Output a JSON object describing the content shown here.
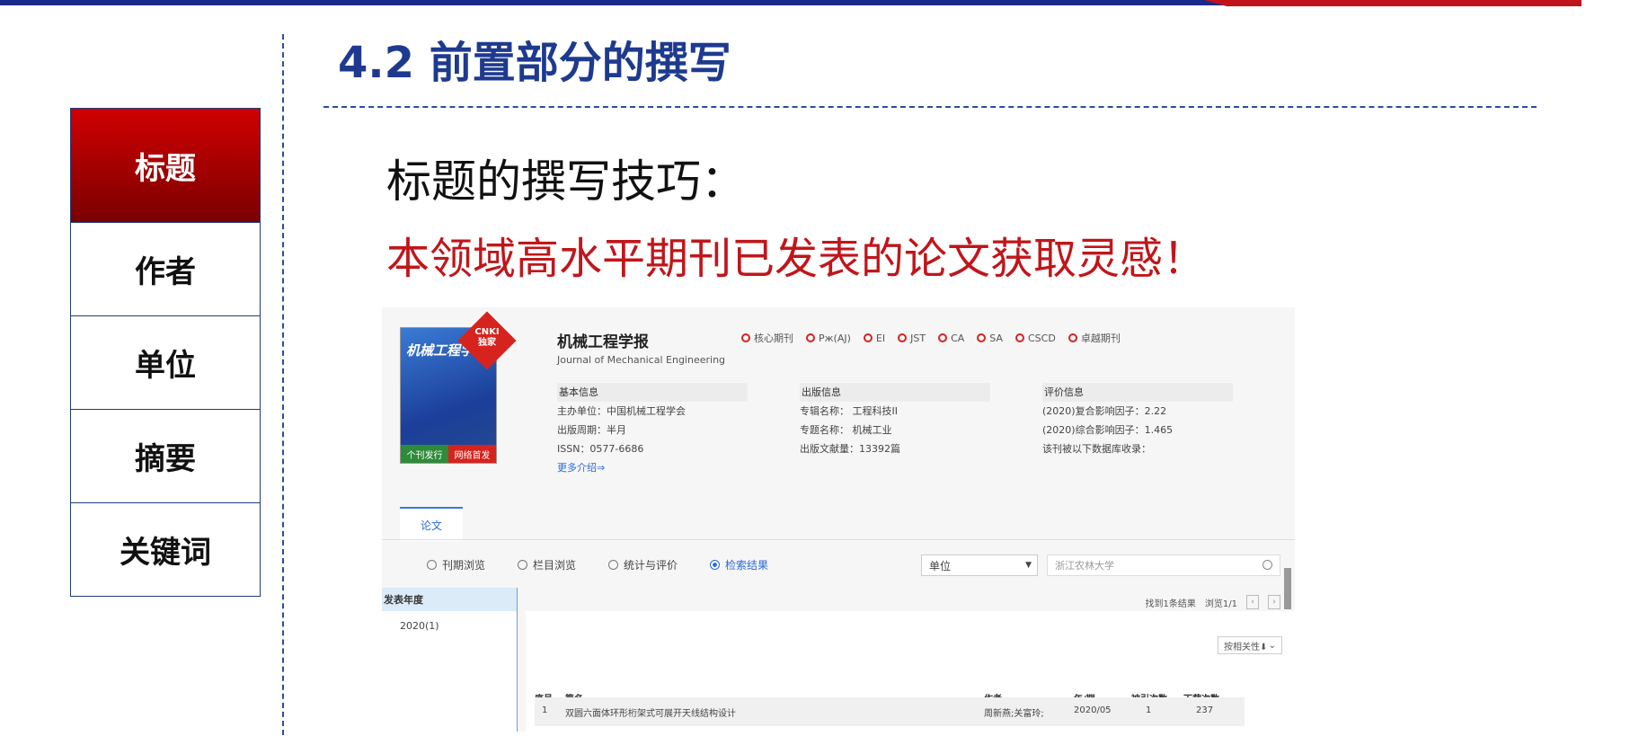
{
  "slide": {
    "title": "4.2 前置部分的撰写",
    "tabs": [
      {
        "label": "标题",
        "active": true
      },
      {
        "label": "作者",
        "active": false
      },
      {
        "label": "单位",
        "active": false
      },
      {
        "label": "摘要",
        "active": false
      },
      {
        "label": "关键词",
        "active": false
      }
    ],
    "heading": "标题的撰写技巧：",
    "highlight": "本领域高水平期刊已发表的论文获取灵感！"
  },
  "colors": {
    "primary_blue": "#1e3a8f",
    "accent_red": "#c0161a",
    "link_blue": "#2a6bd8"
  },
  "screenshot": {
    "cover": {
      "title": "机械工程学报",
      "badge": "CNKI\n独家",
      "bar_left": "个刊发行",
      "bar_right": "网络首发"
    },
    "journal_name": "机械工程学报",
    "journal_en": "Journal of Mechanical Engineering",
    "badges": [
      "核心期刊",
      "Pж(AJ)",
      "EI",
      "JST",
      "CA",
      "SA",
      "CSCD",
      "卓越期刊"
    ],
    "basic_info": {
      "header": "基本信息",
      "lines": [
        "主办单位：中国机械工程学会",
        "出版周期：半月",
        "ISSN：0577-6686"
      ],
      "more": "更多介绍⇒"
    },
    "pub_info": {
      "header": "出版信息",
      "lines": [
        "专辑名称： 工程科技II",
        "专题名称： 机械工业",
        "出版文献量：13392篇"
      ]
    },
    "eval_info": {
      "header": "评价信息",
      "lines": [
        "(2020)复合影响因子：2.22",
        "(2020)综合影响因子：1.465",
        "该刊被以下数据库收录："
      ]
    },
    "tab": "论文",
    "radios": [
      {
        "label": "刊期浏览",
        "on": false
      },
      {
        "label": "栏目浏览",
        "on": false
      },
      {
        "label": "统计与评价",
        "on": false
      },
      {
        "label": "检索结果",
        "on": true
      }
    ],
    "select_value": "单位",
    "search_value": "浙江农林大学",
    "year_header": "发表年度",
    "year_item": "2020(1)",
    "found": "找到1条结果",
    "browse": "浏览1/1",
    "sort": "按相关性⬇",
    "table_headers": {
      "no": "序号",
      "title": "篇名",
      "author": "作者",
      "date": "年/期",
      "cited": "被引次数",
      "downloads": "下载次数"
    },
    "rows": [
      {
        "no": "1",
        "title": "双圆六面体环形桁架式可展开天线结构设计",
        "author": "周新燕;关富玲;",
        "date": "2020/05",
        "cited": "1",
        "downloads": "237"
      }
    ]
  }
}
